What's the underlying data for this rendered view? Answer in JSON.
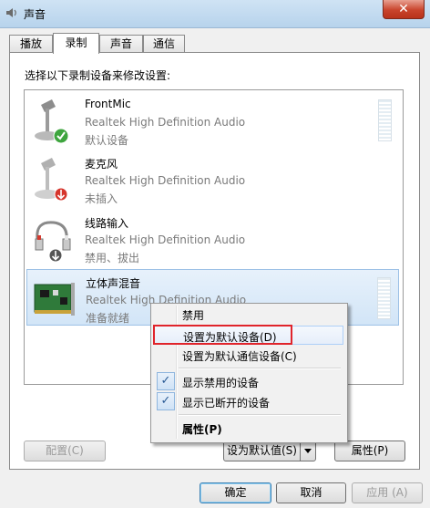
{
  "window": {
    "title": "声音",
    "close_label": "✕"
  },
  "tabs": [
    {
      "label": "播放"
    },
    {
      "label": "录制"
    },
    {
      "label": "声音"
    },
    {
      "label": "通信"
    }
  ],
  "active_tab": "录制",
  "instruction": "选择以下录制设备来修改设置:",
  "devices": [
    {
      "name": "FrontMic",
      "description": "Realtek High Definition Audio",
      "status": "默认设备",
      "icon": "microphone-icon",
      "badge": "green-check-icon"
    },
    {
      "name": "麦克风",
      "description": "Realtek High Definition Audio",
      "status": "未插入",
      "icon": "microphone-icon",
      "badge": "red-arrow-icon"
    },
    {
      "name": "线路输入",
      "description": "Realtek High Definition Audio",
      "status": "禁用、拔出",
      "icon": "line-in-cable-icon",
      "badge": "gray-arrow-icon"
    },
    {
      "name": "立体声混音",
      "description": "Realtek High Definition Audio",
      "status": "准备就绪",
      "icon": "sound-card-icon",
      "selected": true
    }
  ],
  "context_menu": {
    "disable": "禁用",
    "set_default": "设置为默认设备(D)",
    "set_default_comm": "设置为默认通信设备(C)",
    "show_disabled": "显示禁用的设备",
    "show_disconnected": "显示已断开的设备",
    "properties": "属性(P)",
    "show_disabled_checked": true,
    "show_disconnected_checked": true
  },
  "panel_buttons": {
    "configure": "配置(C)",
    "set_default": "设为默认值(S)",
    "properties": "属性(P)"
  },
  "dialog_buttons": {
    "ok": "确定",
    "cancel": "取消",
    "apply": "应用 (A)"
  },
  "colors": {
    "highlight_box": "#e0242b",
    "selection": "#d2e5f7"
  }
}
